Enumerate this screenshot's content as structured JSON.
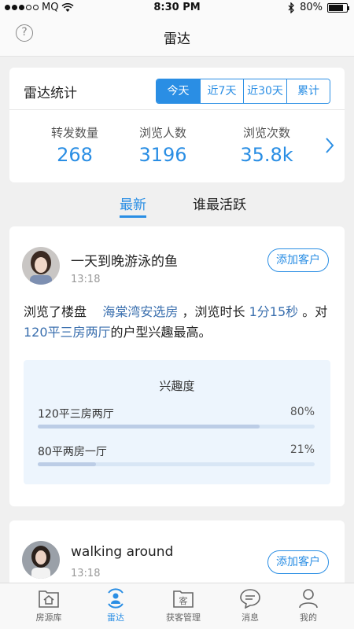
{
  "status_bar": {
    "carrier": "MQ",
    "time": "8:30 PM",
    "battery": "80%",
    "battery_level": 0.8
  },
  "nav": {
    "title": "雷达",
    "help_icon": "help-circle-icon"
  },
  "stats": {
    "title": "雷达统计",
    "segments": [
      "今天",
      "近7天",
      "近30天",
      "累计"
    ],
    "active_segment": "今天",
    "items": [
      {
        "label": "转发数量",
        "value": "268"
      },
      {
        "label": "浏览人数",
        "value": "3196"
      },
      {
        "label": "浏览次数",
        "value": "35.8k"
      }
    ]
  },
  "tabs": [
    "最新",
    "谁最活跃"
  ],
  "activities": [
    {
      "name": "一天到晚游泳的鱼",
      "time": "13:18",
      "add_label": "添加客户",
      "desc_prefix": "浏览了楼盘",
      "building": "海棠湾安选房",
      "desc_mid": "，浏览时长",
      "duration": "1分15秒",
      "desc_mid2": "。对",
      "layout": "120平三房两厅",
      "desc_suffix": "的户型兴趣最高。",
      "interest": {
        "title": "兴趣度",
        "rows": [
          {
            "name": "120平三房两厅",
            "pct": "80%",
            "value": 0.8
          },
          {
            "name": "80平两房一厅",
            "pct": "21%",
            "value": 0.21
          }
        ]
      }
    },
    {
      "name": "walking around",
      "time": "13:18",
      "add_label": "添加客户"
    }
  ],
  "tabbar": [
    {
      "label": "房源库",
      "icon": "house-folder-icon",
      "active": false
    },
    {
      "label": "雷达",
      "icon": "radar-person-icon",
      "active": true
    },
    {
      "label": "获客管理",
      "icon": "customer-folder-icon",
      "active": false
    },
    {
      "label": "消息",
      "icon": "message-bubble-icon",
      "active": false
    },
    {
      "label": "我的",
      "icon": "person-icon",
      "active": false
    }
  ],
  "colors": {
    "accent": "#2a8ee4",
    "link": "#3a6fae",
    "background": "#f0f0f0"
  }
}
